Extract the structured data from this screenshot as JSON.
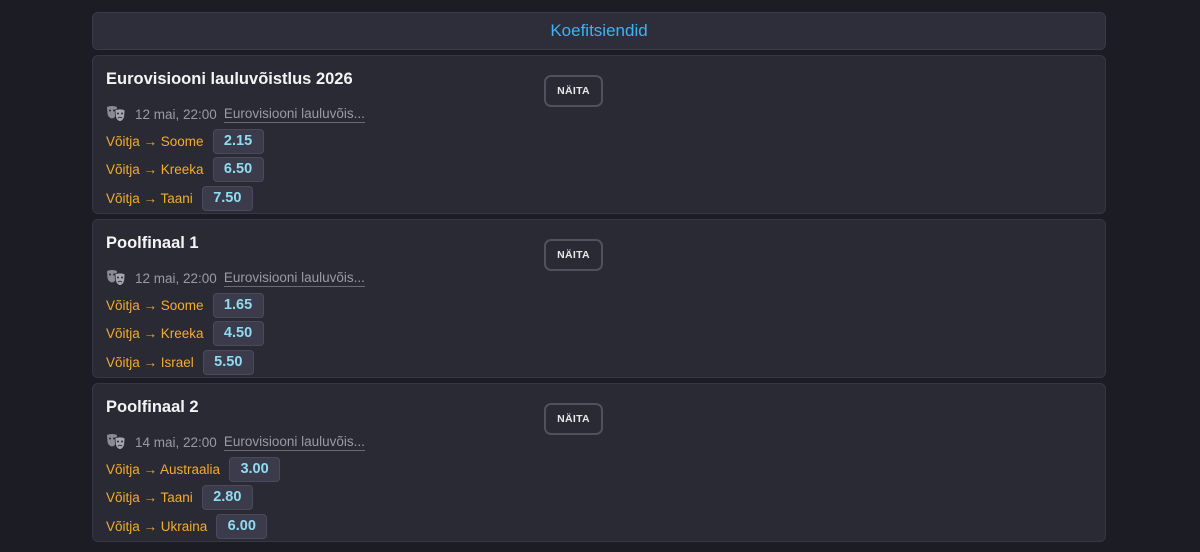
{
  "header": {
    "title": "Koefitsiendid"
  },
  "colors": {
    "background": "#1c1c24",
    "card": "#2a2a35",
    "accent_title": "#3ab4f2",
    "outcome": "#f2ac2e",
    "odd_value": "#8fdcf0"
  },
  "events": [
    {
      "title": "Eurovisiooni lauluvõistlus 2026",
      "button_label": "NÄITA",
      "icon": "theater-masks-icon",
      "date": "12 mai, 22:00",
      "competition": "Eurovisiooni lauluvõis...",
      "odds": [
        {
          "outcome": "Võitja → Soome",
          "value": "2.15"
        },
        {
          "outcome": "Võitja → Kreeka",
          "value": "6.50"
        },
        {
          "outcome": "Võitja → Taani",
          "value": "7.50"
        }
      ]
    },
    {
      "title": "Poolfinaal 1",
      "button_label": "NÄITA",
      "icon": "theater-masks-icon",
      "date": "12 mai, 22:00",
      "competition": "Eurovisiooni lauluvõis...",
      "odds": [
        {
          "outcome": "Võitja → Soome",
          "value": "1.65"
        },
        {
          "outcome": "Võitja → Kreeka",
          "value": "4.50"
        },
        {
          "outcome": "Võitja → Israel",
          "value": "5.50"
        }
      ]
    },
    {
      "title": "Poolfinaal 2",
      "button_label": "NÄITA",
      "icon": "theater-masks-icon",
      "date": "14 mai, 22:00",
      "competition": "Eurovisiooni lauluvõis...",
      "odds": [
        {
          "outcome": "Võitja → Austraalia",
          "value": "3.00"
        },
        {
          "outcome": "Võitja → Taani",
          "value": "2.80"
        },
        {
          "outcome": "Võitja → Ukraina",
          "value": "6.00"
        }
      ]
    }
  ]
}
